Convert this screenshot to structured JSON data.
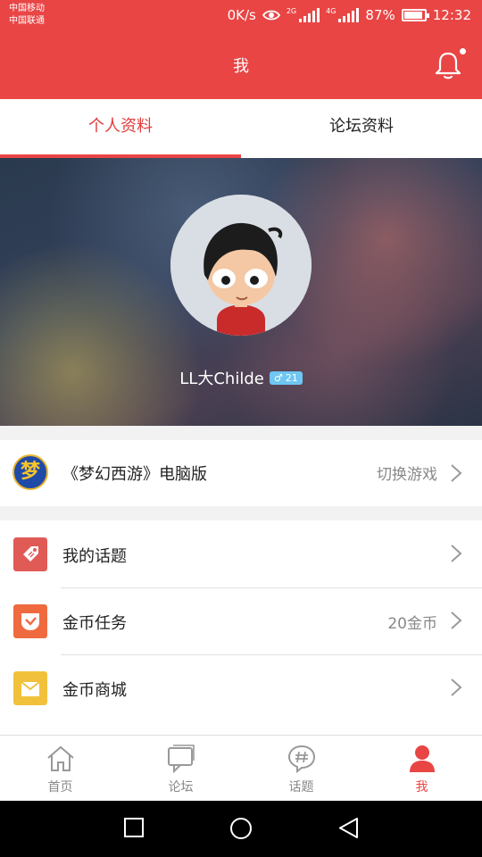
{
  "status_bar": {
    "carrier_1": "中国移动",
    "carrier_2": "中国联通",
    "net_speed": "0K/s",
    "net_2g": "2G",
    "net_4g": "4G",
    "battery": "87%",
    "time": "12:32"
  },
  "header": {
    "title": "我",
    "icons": {
      "notification": "bell-icon"
    }
  },
  "tabs": [
    {
      "label": "个人资料",
      "active": true
    },
    {
      "label": "论坛资料",
      "active": false
    }
  ],
  "profile": {
    "username": "LL大Childe",
    "gender_symbol": "♂",
    "level": "21"
  },
  "game": {
    "logo_text": "梦",
    "name": "《梦幻西游》电脑版",
    "switch_label": "切换游戏"
  },
  "menu": [
    {
      "label": "我的话题",
      "value": "",
      "icon": "tag-icon",
      "color": "#e05a56"
    },
    {
      "label": "金币任务",
      "value": "20金币",
      "icon": "check-icon",
      "color": "#ef6a3f"
    },
    {
      "label": "金币商城",
      "value": "",
      "icon": "mall-icon",
      "color": "#f2c13c"
    }
  ],
  "bottom_nav": [
    {
      "label": "首页",
      "icon": "home-icon",
      "active": false
    },
    {
      "label": "论坛",
      "icon": "forum-icon",
      "active": false
    },
    {
      "label": "话题",
      "icon": "hashtag-icon",
      "active": false
    },
    {
      "label": "我",
      "icon": "profile-icon",
      "active": true
    }
  ],
  "colors": {
    "accent": "#e94545",
    "muted": "#888888"
  }
}
